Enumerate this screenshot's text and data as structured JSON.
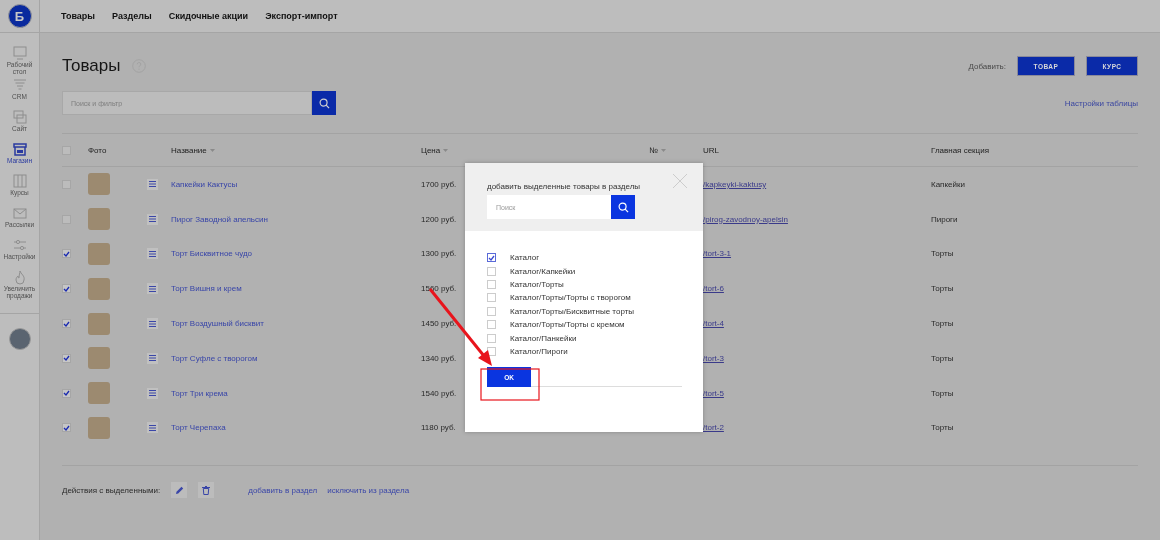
{
  "logo": {
    "letter": "Б"
  },
  "top_nav": [
    "Товары",
    "Разделы",
    "Скидочные акции",
    "Экспорт-импорт"
  ],
  "sidebar": {
    "items": [
      {
        "kind": "desktop",
        "label": "Рабочий стол",
        "selected": false
      },
      {
        "kind": "funnel",
        "label": "CRM",
        "selected": false
      },
      {
        "kind": "layers",
        "label": "Сайт",
        "selected": false
      },
      {
        "kind": "store",
        "label": "Магазин",
        "selected": true
      },
      {
        "kind": "columns",
        "label": "Курсы",
        "selected": false
      },
      {
        "kind": "envelope",
        "label": "Рассылки",
        "selected": false
      },
      {
        "kind": "sliders",
        "label": "Настройки",
        "selected": false
      },
      {
        "kind": "flame",
        "label": "Увеличить продажи",
        "selected": false
      }
    ]
  },
  "page": {
    "title": "Товары",
    "add_label": "Добавить:",
    "add_buttons": [
      "ТОВАР",
      "КУРС"
    ],
    "search": {
      "placeholder": "Поиск и фильтр"
    },
    "table_settings": "Настройки таблицы"
  },
  "table": {
    "select_all_checked": false,
    "columns": [
      {
        "label": "Фото",
        "sortable": false
      },
      {
        "label": "Название",
        "sortable": true
      },
      {
        "label": "Цена",
        "sortable": true
      },
      {
        "label": "№",
        "sortable": true
      },
      {
        "label": "URL",
        "sortable": false
      },
      {
        "label": "Главная секция",
        "sortable": false
      }
    ],
    "rows": [
      {
        "checked": false,
        "name": "Капкейки Кактусы",
        "price": "1700 руб.",
        "url": "/kapkeyki-kaktusy",
        "section": "Капкейки"
      },
      {
        "checked": false,
        "name": "Пирог Заводной апельсин",
        "price": "1200 руб.",
        "url": "/pirog-zavodnoy-apelsin",
        "section": "Пироги"
      },
      {
        "checked": true,
        "name": "Торт Бисквитное чудо",
        "price": "1300 руб.",
        "url": "/tort-3-1",
        "section": "Торты"
      },
      {
        "checked": true,
        "name": "Торт Вишня и крем",
        "price": "1560 руб.",
        "url": "/tort-6",
        "section": "Торты"
      },
      {
        "checked": true,
        "name": "Торт Воздушный бисквит",
        "price": "1450 руб.",
        "url": "/tort-4",
        "section": "Торты"
      },
      {
        "checked": true,
        "name": "Торт Суфле с творогом",
        "price": "1340 руб.",
        "url": "/tort-3",
        "section": "Торты"
      },
      {
        "checked": true,
        "name": "Торт Три крема",
        "price": "1540 руб.",
        "url": "/tort-5",
        "section": "Торты"
      },
      {
        "checked": true,
        "name": "Торт Черепаха",
        "price": "1180 руб.",
        "url": "/tort-2",
        "section": "Торты"
      }
    ]
  },
  "actions": {
    "label": "Действия с выделенными:",
    "links": [
      "добавить в раздел",
      "исключить из раздела"
    ]
  },
  "dialog": {
    "title": "добавить выделенные товары в разделы",
    "search": {
      "placeholder": "Поиск"
    },
    "options": [
      {
        "label": "Каталог",
        "checked": true
      },
      {
        "label": "Каталог/Капкейки",
        "checked": false
      },
      {
        "label": "Каталог/Торты",
        "checked": false
      },
      {
        "label": "Каталог/Торты/Торты с творогом",
        "checked": false
      },
      {
        "label": "Каталог/Торты/Бисквитные торты",
        "checked": false
      },
      {
        "label": "Каталог/Торты/Торты с кремом",
        "checked": false
      },
      {
        "label": "Каталог/Панкейки",
        "checked": false
      },
      {
        "label": "Каталог/Пироги",
        "checked": false
      }
    ],
    "ok": "OK"
  }
}
